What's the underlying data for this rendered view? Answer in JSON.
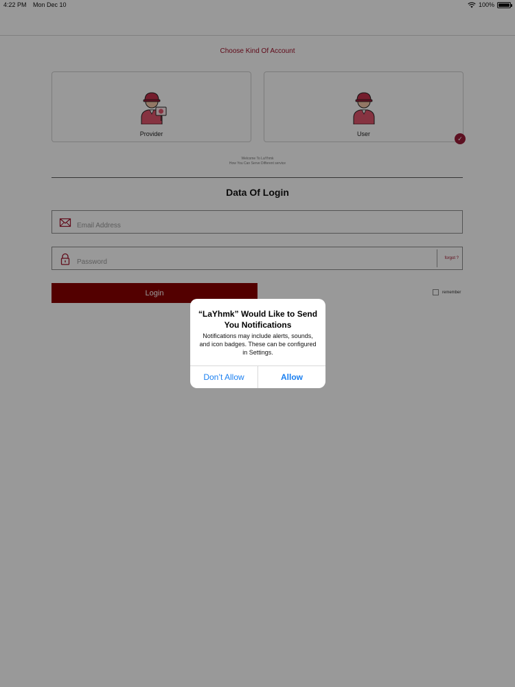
{
  "status_bar": {
    "time": "4:22 PM",
    "date": "Mon Dec 10",
    "battery": "100%"
  },
  "account": {
    "title": "Choose Kind Of Account",
    "provider_label": "Provider",
    "user_label": "User",
    "selected": "User"
  },
  "welcome": {
    "line1": "Welcome To LaYhmk",
    "line2": "How You Can Serve Different service"
  },
  "login": {
    "title": "Data Of Login",
    "email_placeholder": "Email Address",
    "password_placeholder": "Password",
    "forgot_label": "forgot ?",
    "login_button": "Login",
    "remember_label": "remember"
  },
  "alert": {
    "title": "“LaYhmk” Would Like to Send You Notifications",
    "message": "Notifications may include alerts, sounds, and icon badges. These can be configured in Settings.",
    "deny_label": "Don’t Allow",
    "allow_label": "Allow"
  },
  "colors": {
    "accent": "#a0122b",
    "button": "#8b0000",
    "alert_button": "#1a7ff0"
  }
}
